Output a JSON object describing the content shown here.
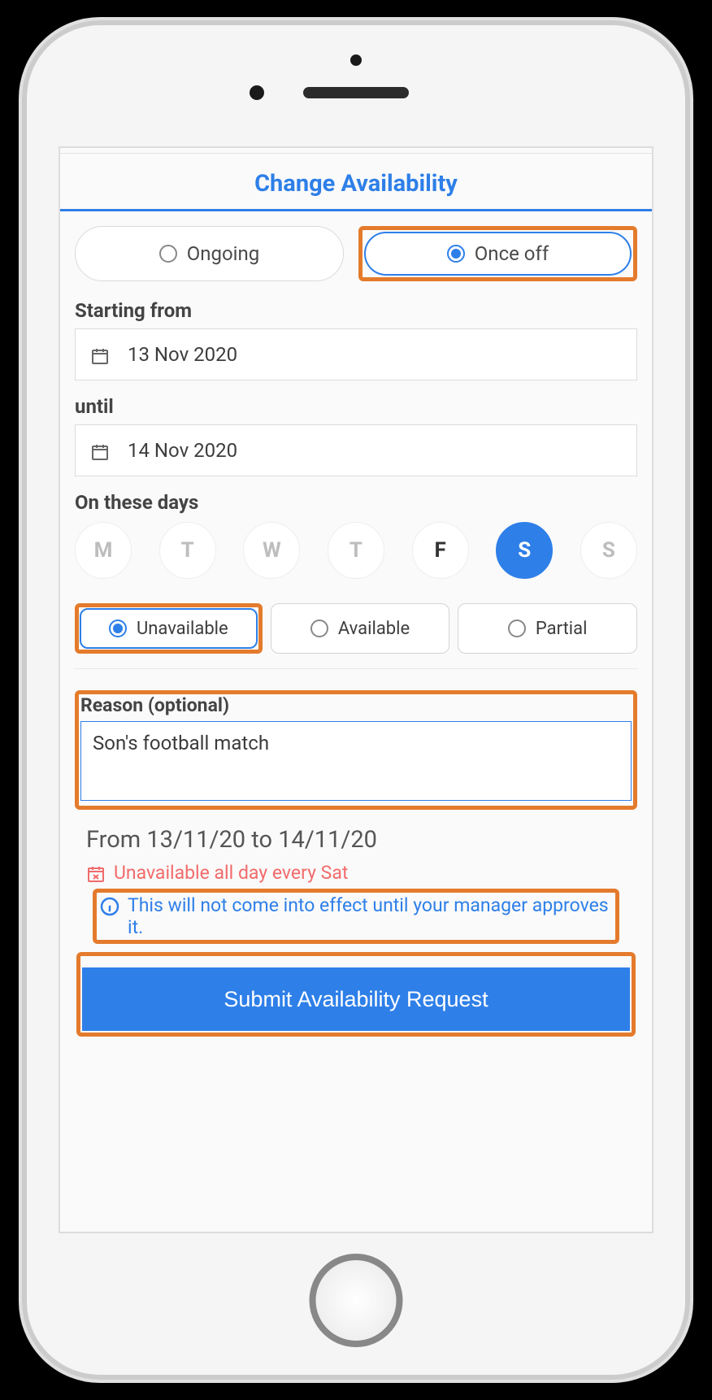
{
  "header": {
    "title": "Change Availability"
  },
  "frequency": {
    "ongoing": "Ongoing",
    "once_off": "Once off",
    "selected": "once_off"
  },
  "dates": {
    "start_label": "Starting from",
    "start_value": "13 Nov 2020",
    "until_label": "until",
    "until_value": "14 Nov 2020"
  },
  "days": {
    "label": "On these days",
    "items": [
      "M",
      "T",
      "W",
      "T",
      "F",
      "S",
      "S"
    ]
  },
  "status": {
    "unavailable": "Unavailable",
    "available": "Available",
    "partial": "Partial",
    "selected": "unavailable"
  },
  "reason": {
    "label": "Reason (optional)",
    "value": "Son's football match"
  },
  "summary": {
    "range": "From 13/11/20 to 14/11/20",
    "status_line": "Unavailable all day every Sat",
    "info": "This will not come into effect until your manager approves it."
  },
  "submit": {
    "label": "Submit Availability Request"
  }
}
